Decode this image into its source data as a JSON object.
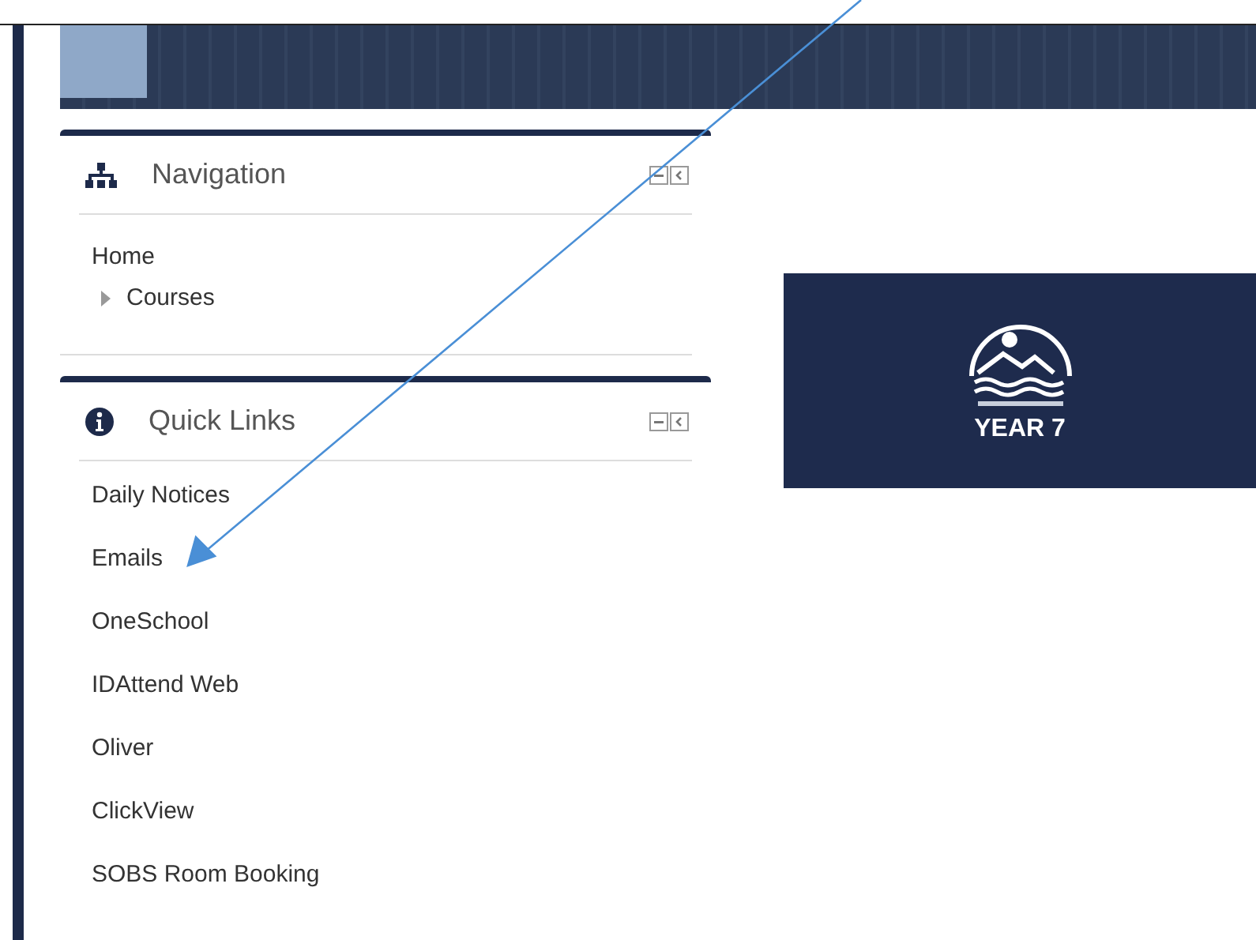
{
  "blocks": [
    {
      "kind": "navigation",
      "title": "Navigation",
      "items": [
        {
          "label": "Home",
          "expandable": false
        },
        {
          "label": "Courses",
          "expandable": true
        }
      ]
    },
    {
      "kind": "info",
      "title": "Quick Links",
      "links": [
        "Daily Notices",
        "Emails",
        "OneSchool",
        "IDAttend Web",
        "Oliver",
        "ClickView",
        "SOBS Room Booking"
      ]
    }
  ],
  "tile": {
    "caption": "YEAR 7"
  }
}
